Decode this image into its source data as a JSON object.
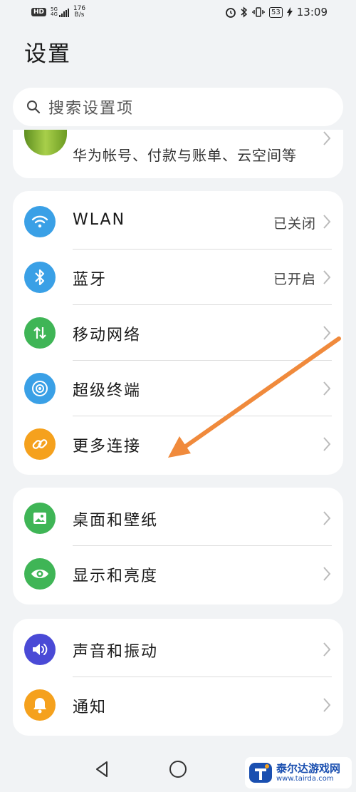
{
  "status_bar": {
    "hd": "HD",
    "signal_top": "5G",
    "signal_bottom": "4G",
    "speed_value": "176",
    "speed_unit": "B/s",
    "battery": "53",
    "time": "13:09"
  },
  "page_title": "设置",
  "search": {
    "placeholder": "搜索设置项"
  },
  "account": {
    "subtitle": "华为帐号、付款与账单、云空间等"
  },
  "connectivity": [
    {
      "label": "WLAN",
      "value": "已关闭",
      "icon": "wifi-icon",
      "color": "#3aa0e6"
    },
    {
      "label": "蓝牙",
      "value": "已开启",
      "icon": "bluetooth-icon",
      "color": "#3aa0e6"
    },
    {
      "label": "移动网络",
      "value": "",
      "icon": "mobile-data-icon",
      "color": "#3fb556"
    },
    {
      "label": "超级终端",
      "value": "",
      "icon": "super-device-icon",
      "color": "#3aa0e6"
    },
    {
      "label": "更多连接",
      "value": "",
      "icon": "link-icon",
      "color": "#f5a11d"
    }
  ],
  "display": [
    {
      "label": "桌面和壁纸",
      "icon": "wallpaper-icon",
      "color": "#3fb556"
    },
    {
      "label": "显示和亮度",
      "icon": "eye-icon",
      "color": "#3fb556"
    }
  ],
  "sound": [
    {
      "label": "声音和振动",
      "icon": "speaker-icon",
      "color": "#4a4ad6"
    },
    {
      "label": "通知",
      "icon": "bell-icon",
      "color": "#f5a11d"
    }
  ],
  "watermark": {
    "name": "泰尔达游戏网",
    "url": "www.tairda.com"
  },
  "annotation_color": "#f08a3c"
}
